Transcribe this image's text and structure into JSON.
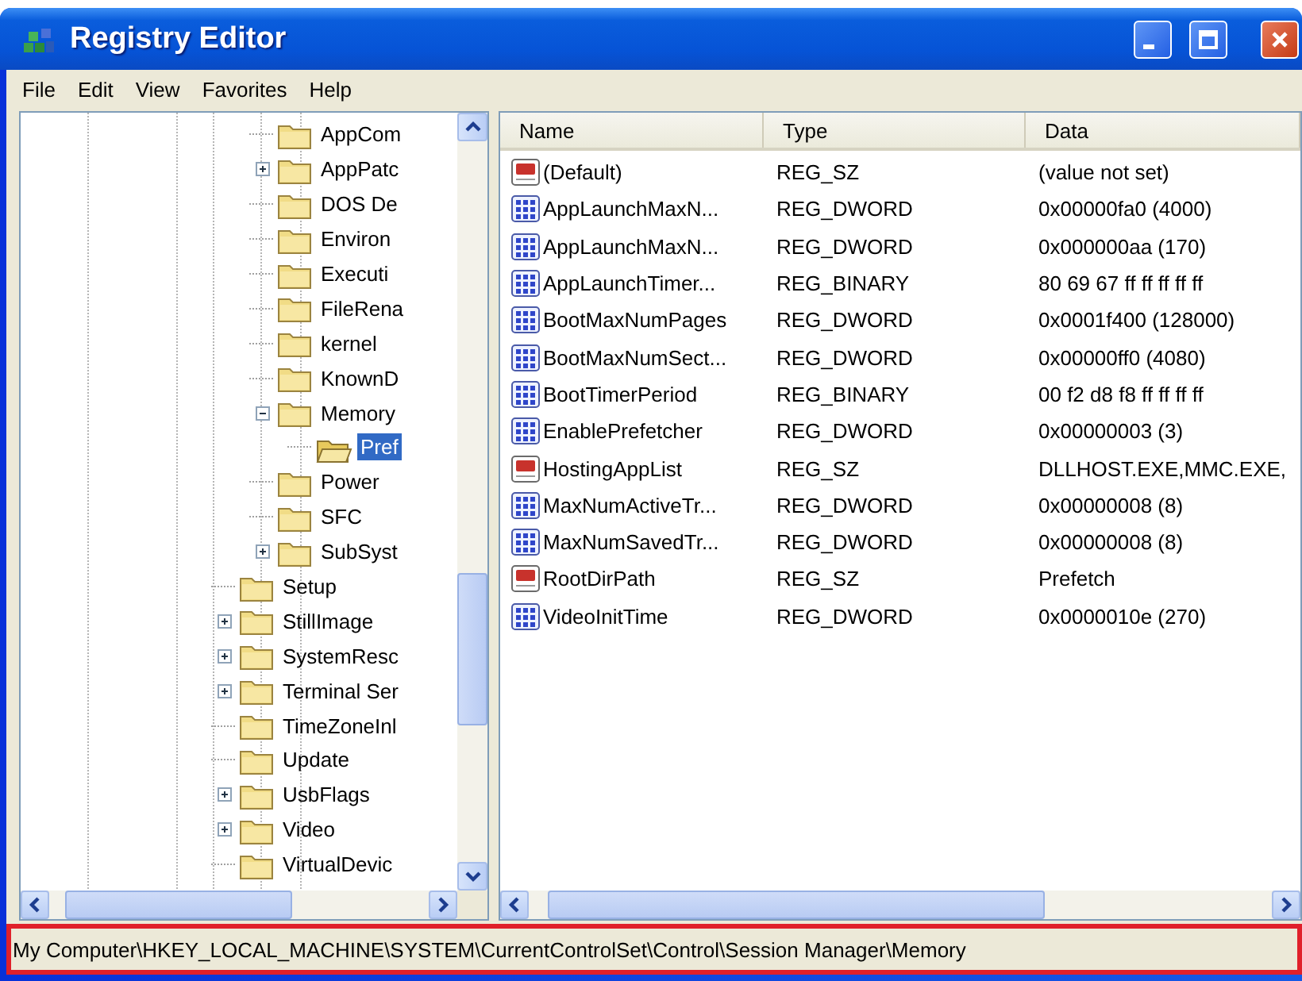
{
  "window": {
    "title": "Registry Editor"
  },
  "menu": [
    "File",
    "Edit",
    "View",
    "Favorites",
    "Help"
  ],
  "tree": {
    "nodes": [
      {
        "children": [
          {
            "label": "AppCom",
            "has_children": false,
            "expanded": false,
            "selected": false
          },
          {
            "label": "AppPatc",
            "has_children": true,
            "expanded": false,
            "selected": false
          },
          {
            "label": "DOS De",
            "has_children": false,
            "expanded": false,
            "selected": false
          },
          {
            "label": "Environ",
            "has_children": false,
            "expanded": false,
            "selected": false
          },
          {
            "label": "Executi",
            "has_children": false,
            "expanded": false,
            "selected": false
          },
          {
            "label": "FileRena",
            "has_children": false,
            "expanded": false,
            "selected": false
          },
          {
            "label": "kernel",
            "has_children": false,
            "expanded": false,
            "selected": false
          },
          {
            "label": "KnownD",
            "has_children": false,
            "expanded": false,
            "selected": false
          },
          {
            "label": "Memory",
            "has_children": true,
            "expanded": true,
            "selected": false,
            "children": [
              {
                "label": "Pref",
                "has_children": false,
                "expanded": false,
                "selected": true
              }
            ]
          },
          {
            "label": "Power",
            "has_children": false,
            "expanded": false,
            "selected": false
          },
          {
            "label": "SFC",
            "has_children": false,
            "expanded": false,
            "selected": false
          },
          {
            "label": "SubSyst",
            "has_children": true,
            "expanded": false,
            "selected": false
          }
        ]
      },
      {
        "label": "Setup",
        "has_children": false,
        "expanded": false,
        "selected": false
      },
      {
        "label": "StillImage",
        "has_children": true,
        "expanded": false,
        "selected": false
      },
      {
        "label": "SystemResc",
        "has_children": true,
        "expanded": false,
        "selected": false
      },
      {
        "label": "Terminal Ser",
        "has_children": true,
        "expanded": false,
        "selected": false
      },
      {
        "label": "TimeZoneInl",
        "has_children": false,
        "expanded": false,
        "selected": false
      },
      {
        "label": "Update",
        "has_children": false,
        "expanded": false,
        "selected": false
      },
      {
        "label": "UsbFlags",
        "has_children": true,
        "expanded": false,
        "selected": false
      },
      {
        "label": "Video",
        "has_children": true,
        "expanded": false,
        "selected": false
      },
      {
        "label": "VirtualDevic",
        "has_children": false,
        "expanded": false,
        "selected": false
      }
    ]
  },
  "list": {
    "columns": [
      "Name",
      "Type",
      "Data"
    ],
    "rows": [
      {
        "kind": "string",
        "name": "(Default)",
        "type": "REG_SZ",
        "data": "(value not set)"
      },
      {
        "kind": "binary",
        "name": "AppLaunchMaxN...",
        "type": "REG_DWORD",
        "data": "0x00000fa0 (4000)"
      },
      {
        "kind": "binary",
        "name": "AppLaunchMaxN...",
        "type": "REG_DWORD",
        "data": "0x000000aa (170)"
      },
      {
        "kind": "binary",
        "name": "AppLaunchTimer...",
        "type": "REG_BINARY",
        "data": "80 69 67 ff ff ff ff ff"
      },
      {
        "kind": "binary",
        "name": "BootMaxNumPages",
        "type": "REG_DWORD",
        "data": "0x0001f400 (128000)"
      },
      {
        "kind": "binary",
        "name": "BootMaxNumSect...",
        "type": "REG_DWORD",
        "data": "0x00000ff0 (4080)"
      },
      {
        "kind": "binary",
        "name": "BootTimerPeriod",
        "type": "REG_BINARY",
        "data": "00 f2 d8 f8 ff ff ff ff"
      },
      {
        "kind": "binary",
        "name": "EnablePrefetcher",
        "type": "REG_DWORD",
        "data": "0x00000003 (3)"
      },
      {
        "kind": "string",
        "name": "HostingAppList",
        "type": "REG_SZ",
        "data": "DLLHOST.EXE,MMC.EXE,"
      },
      {
        "kind": "binary",
        "name": "MaxNumActiveTr...",
        "type": "REG_DWORD",
        "data": "0x00000008 (8)"
      },
      {
        "kind": "binary",
        "name": "MaxNumSavedTr...",
        "type": "REG_DWORD",
        "data": "0x00000008 (8)"
      },
      {
        "kind": "string",
        "name": "RootDirPath",
        "type": "REG_SZ",
        "data": "Prefetch"
      },
      {
        "kind": "binary",
        "name": "VideoInitTime",
        "type": "REG_DWORD",
        "data": "0x0000010e (270)"
      }
    ]
  },
  "status_bar": "My Computer\\HKEY_LOCAL_MACHINE\\SYSTEM\\CurrentControlSet\\Control\\Session Manager\\Memory"
}
